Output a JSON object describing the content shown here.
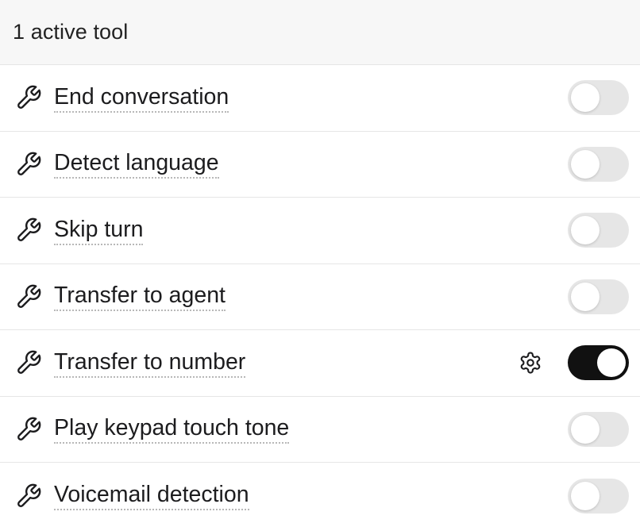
{
  "header": {
    "title": "1 active tool"
  },
  "tools": [
    {
      "label": "End conversation",
      "enabled": false,
      "has_settings": false
    },
    {
      "label": "Detect language",
      "enabled": false,
      "has_settings": false
    },
    {
      "label": "Skip turn",
      "enabled": false,
      "has_settings": false
    },
    {
      "label": "Transfer to agent",
      "enabled": false,
      "has_settings": false
    },
    {
      "label": "Transfer to number",
      "enabled": true,
      "has_settings": true
    },
    {
      "label": "Play keypad touch tone",
      "enabled": false,
      "has_settings": false
    },
    {
      "label": "Voicemail detection",
      "enabled": false,
      "has_settings": false
    }
  ],
  "icons": {
    "tool": "wrench-icon",
    "settings": "gear-icon"
  },
  "colors": {
    "toggle_on": "#111111",
    "toggle_off": "#e6e6e6",
    "header_bg": "#f7f7f7",
    "divider": "#e6e6e6"
  }
}
